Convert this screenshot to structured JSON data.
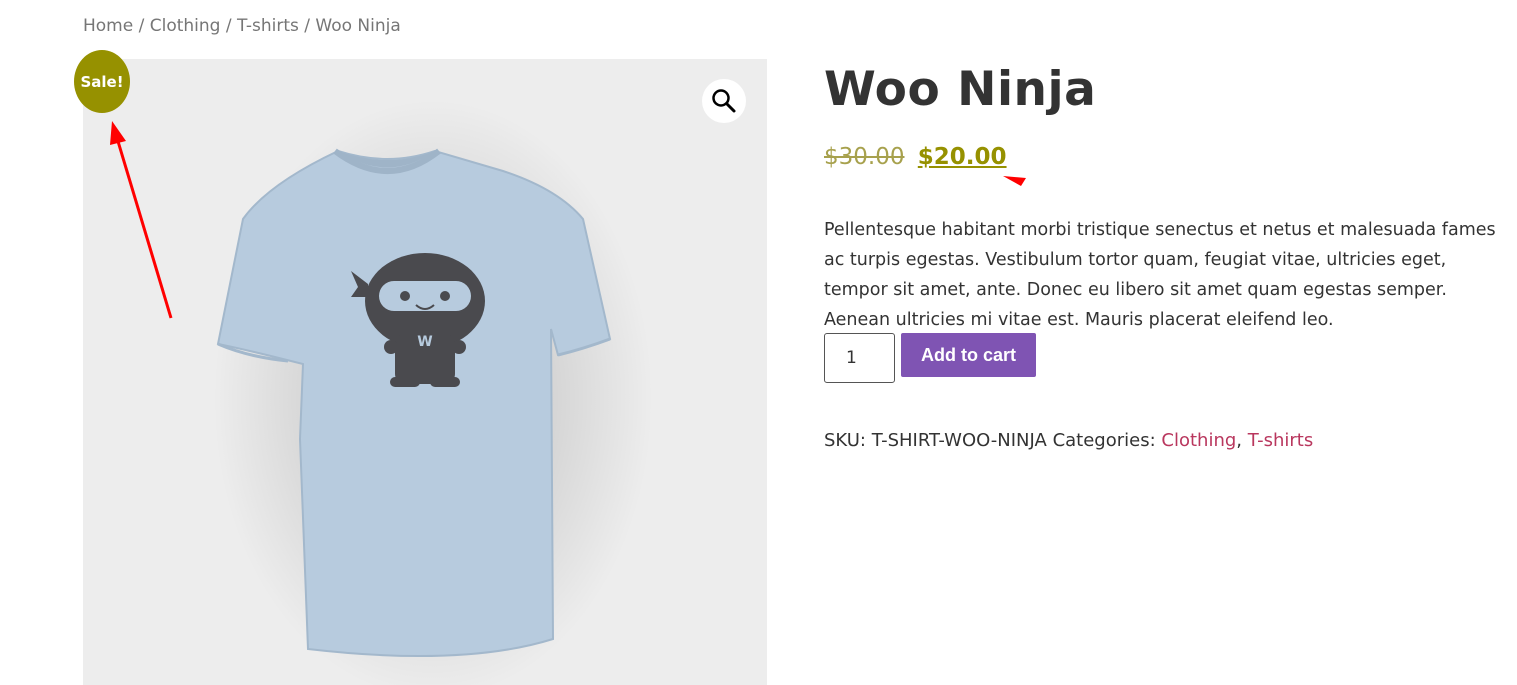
{
  "colors": {
    "sale_badge": "#969100",
    "price": "#969100",
    "old_price": "#a7a14d",
    "add_button": "#7f54b3",
    "category_link": "#b9375e",
    "annotation_arrow": "#ff0000",
    "gallery_bg": "#ededed"
  },
  "breadcrumb": {
    "home": "Home",
    "sep1": "/",
    "clothing": "Clothing",
    "sep2": "/",
    "tshirts": "T-shirts",
    "sep3": "/",
    "current": "Woo Ninja"
  },
  "gallery": {
    "sale_badge": "Sale!",
    "zoom_icon": "magnifier-icon",
    "product_image": "t-shirt-with-ninja-print",
    "ninja_letter": "W"
  },
  "product": {
    "title": "Woo Ninja",
    "old_price": "$30.00",
    "price": "$20.00",
    "description": "Pellentesque habitant morbi tristique senectus et netus et malesuada fames ac turpis egestas. Vestibulum tortor quam, feugiat vitae, ultricies eget, tempor sit amet, ante. Donec eu libero sit amet quam egestas semper. Aenean ultricies mi vitae est. Mauris placerat eleifend leo.",
    "quantity": "1",
    "add_to_cart": "Add to cart"
  },
  "meta": {
    "sku_label": "SKU:",
    "sku": "T-SHIRT-WOO-NINJA",
    "categories_label": "Categories:",
    "category1": "Clothing",
    "comma": ",",
    "category2": "T-shirts"
  }
}
